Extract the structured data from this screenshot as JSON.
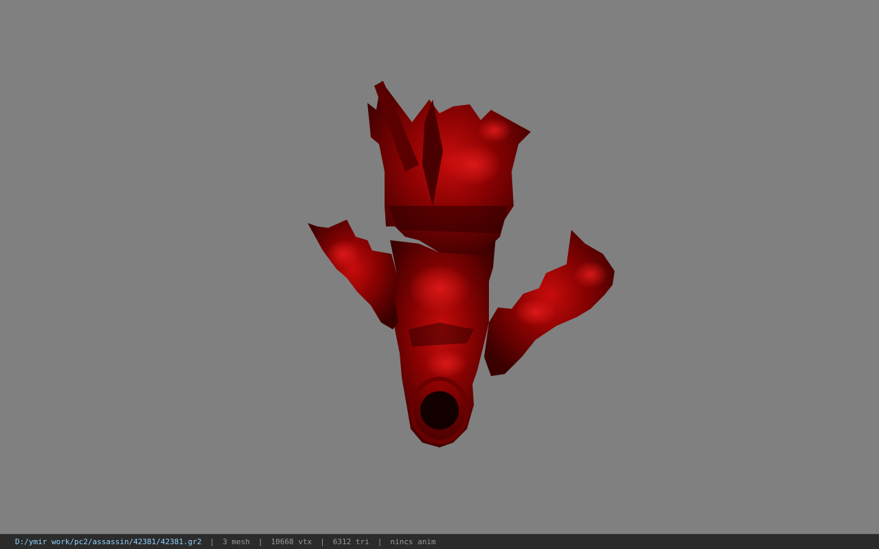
{
  "viewport": {
    "background": "#808080",
    "model_primary": "#7a0000",
    "model_highlight": "#d41010",
    "model_shadow": "#220000"
  },
  "statusbar": {
    "path": "D:/ymir work/pc2/assassin/42381/42381.gr2",
    "separator": "|",
    "mesh": "3 mesh",
    "vtx": "10668 vtx",
    "tri": "6312 tri",
    "anim": "nincs anim"
  }
}
